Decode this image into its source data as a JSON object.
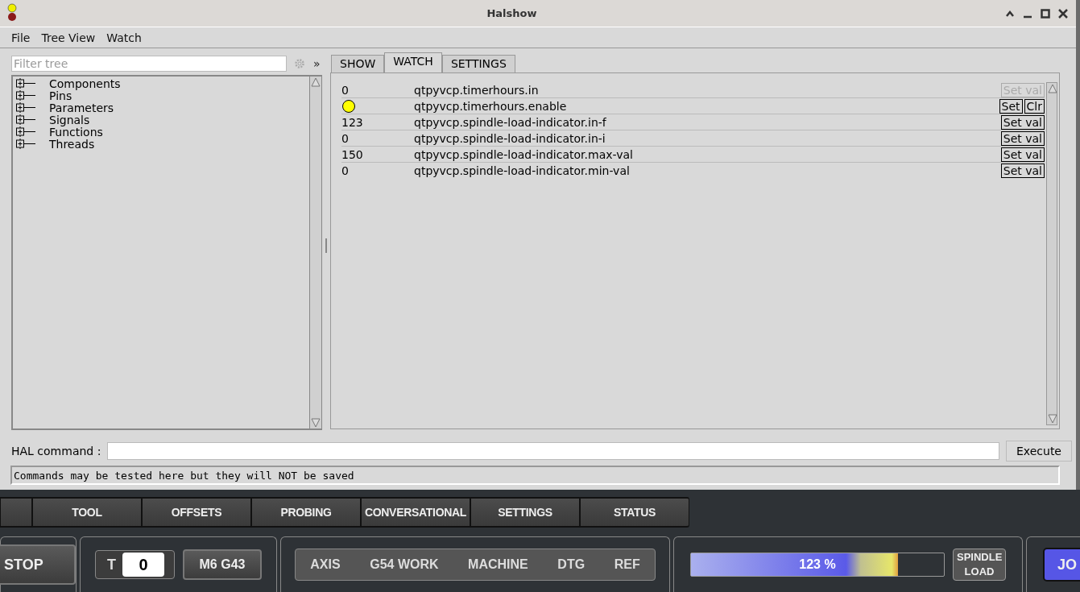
{
  "window": {
    "title": "Halshow"
  },
  "menu": [
    "File",
    "Tree View",
    "Watch"
  ],
  "filter": {
    "placeholder": "Filter tree"
  },
  "collapse_toggle": "»",
  "tree": [
    {
      "label": "Components",
      "expanded": false
    },
    {
      "label": "Pins",
      "expanded": false
    },
    {
      "label": "Parameters",
      "expanded": false
    },
    {
      "label": "Signals",
      "expanded": false
    },
    {
      "label": "Functions",
      "expanded": false
    },
    {
      "label": "Threads",
      "expanded": false
    }
  ],
  "tabs": [
    {
      "label": "SHOW",
      "selected": false
    },
    {
      "label": "WATCH",
      "selected": true
    },
    {
      "label": "SETTINGS",
      "selected": false
    }
  ],
  "watch": [
    {
      "kind": "value",
      "value": "0",
      "pin": "qtpyvcp.timerhours.in",
      "buttons": [
        {
          "label": "Set val",
          "disabled": true
        }
      ]
    },
    {
      "kind": "led",
      "on": true,
      "pin": "qtpyvcp.timerhours.enable",
      "buttons": [
        {
          "label": "Set",
          "disabled": false
        },
        {
          "label": "Clr",
          "disabled": false
        }
      ]
    },
    {
      "kind": "value",
      "value": "123",
      "pin": "qtpyvcp.spindle-load-indicator.in-f",
      "buttons": [
        {
          "label": "Set val",
          "disabled": false
        }
      ]
    },
    {
      "kind": "value",
      "value": "0",
      "pin": "qtpyvcp.spindle-load-indicator.in-i",
      "buttons": [
        {
          "label": "Set val",
          "disabled": false
        }
      ]
    },
    {
      "kind": "value",
      "value": "150",
      "pin": "qtpyvcp.spindle-load-indicator.max-val",
      "buttons": [
        {
          "label": "Set val",
          "disabled": false
        }
      ]
    },
    {
      "kind": "value",
      "value": "0",
      "pin": "qtpyvcp.spindle-load-indicator.min-val",
      "buttons": [
        {
          "label": "Set val",
          "disabled": false
        }
      ]
    }
  ],
  "hal_command": {
    "label": "HAL command :",
    "button": "Execute"
  },
  "status": "Commands may be tested here but they will NOT be saved",
  "app": {
    "tabs": [
      "TOOL",
      "OFFSETS",
      "PROBING",
      "CONVERSATIONAL",
      "SETTINGS",
      "STATUS"
    ],
    "stop_button": "STOP",
    "tool": {
      "label": "T",
      "value": "0"
    },
    "m6_button": "M6 G43",
    "dro_headers": [
      "AXIS",
      "G54 WORK",
      "MACHINE",
      "DTG",
      "REF"
    ],
    "spindle": {
      "level": 0.82,
      "reading": "123 %",
      "button": "SPINDLE LOAD"
    },
    "jog_button": "JO"
  }
}
